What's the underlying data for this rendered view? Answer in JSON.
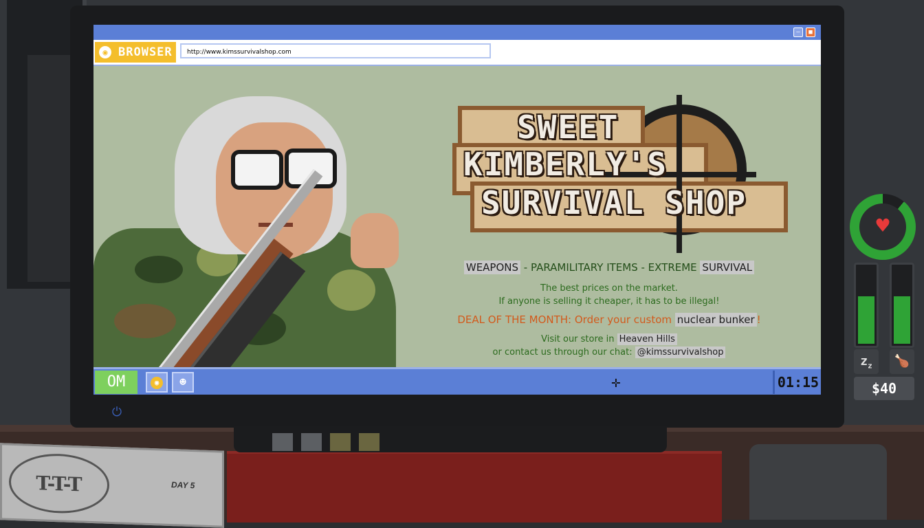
{
  "browser": {
    "tab_label": "BROWSER",
    "url": "http://www.kimssurvivalshop.com"
  },
  "page": {
    "logo": {
      "line1": "SWEET",
      "line2": "KIMBERLY'S",
      "line3": "SURVIVAL SHOP"
    },
    "tagline": {
      "part1": "WEAPONS",
      "sep1": " - PARAMILITARY ITEMS - EXTREME ",
      "part2": "SURVIVAL"
    },
    "best_prices": "The best prices on the market.",
    "cheaper": "If anyone is selling it cheaper, it has to be illegal!",
    "deal_prefix": "DEAL OF THE MONTH: Order your custom ",
    "deal_item": "nuclear bunker",
    "deal_suffix": "!",
    "visit_prefix": "Visit our store in ",
    "visit_place": "Heaven Hills",
    "contact_prefix": "or contact us through our chat: ",
    "contact_handle": "@kimssurvivalshop"
  },
  "taskbar": {
    "start_label": "OM",
    "clock": "01:15"
  },
  "hud": {
    "money": "$40",
    "health_fraction": 0.89,
    "sleep_fraction": 0.62,
    "hunger_fraction": 0.62,
    "sleep_icon": "zz-icon",
    "hunger_icon": "drumstick-icon"
  },
  "newspaper": {
    "masthead": "T-T-T",
    "day": "DAY 5"
  },
  "colors": {
    "titlebar": "#5b7fd6",
    "browser_tab": "#f4be2c",
    "page_bg": "#aebca0",
    "health_green": "#2fa336",
    "deal_orange": "#d25a1c"
  }
}
